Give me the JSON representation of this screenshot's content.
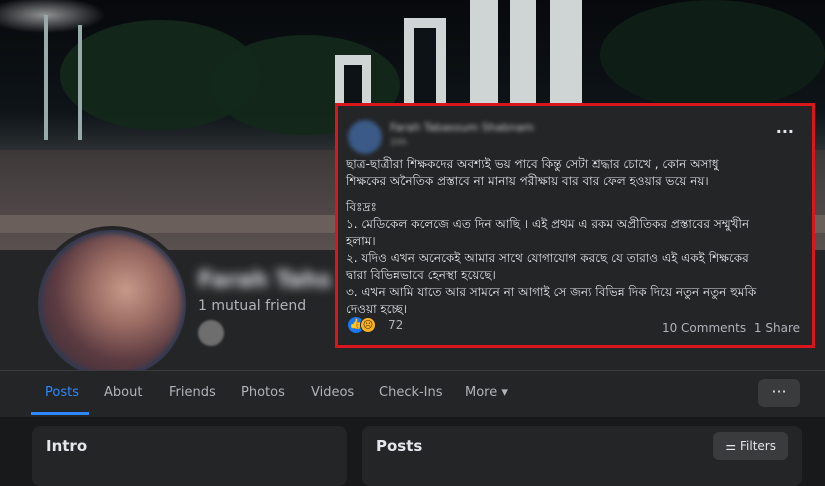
{
  "profile": {
    "name": "Farah Tahs",
    "mutual_friends": "1 mutual friend"
  },
  "tabs": [
    {
      "label": "Posts",
      "active": true
    },
    {
      "label": "About"
    },
    {
      "label": "Friends"
    },
    {
      "label": "Photos"
    },
    {
      "label": "Videos"
    },
    {
      "label": "Check-Ins"
    },
    {
      "label": "More"
    }
  ],
  "more_menu_icon": "ellipsis-icon",
  "intro": {
    "title": "Intro"
  },
  "posts": {
    "title": "Posts",
    "filters_label": "Filters"
  },
  "post": {
    "author": "Farah Tabassum Shabnam",
    "time": "20h",
    "lines": [
      "ছাত্র-ছাত্রীরা শিক্ষকদের অবশ্যই ভয় পাবে কিন্তু সেটা শ্রদ্ধার চোখে , কোন অসাধু",
      "শিক্ষকের অনৈতিক প্রস্তাবে না মানায় পরীক্ষায় বার বার ফেল হওয়ার ভয়ে নয়।",
      "বিঃদ্রঃ",
      "১. মেডিকেল কলেজে এত দিন আছি । এই প্রথম এ রকম অপ্রীতিকর প্রস্তাবের সম্মুখীন",
      "হলাম।",
      "২. যদিও এখন অনেকেই আমার সাথে যোগাযোগ করছে যে তারাও এই একই শিক্ষকের",
      "দ্বারা বিভিন্নভাবে হেনস্থা হয়েছে।",
      "৩. এখন আমি যাতে আর সামনে না আগাই সে জন্য বিভিন্ন দিক দিয়ে নতুন নতুন হুমকি",
      "দেওয়া হচ্ছে।"
    ],
    "reaction_count": "72",
    "comments": "10 Comments",
    "shares": "1 Share"
  },
  "colors": {
    "highlight": "#d9161c",
    "accent": "#2d88ff"
  }
}
